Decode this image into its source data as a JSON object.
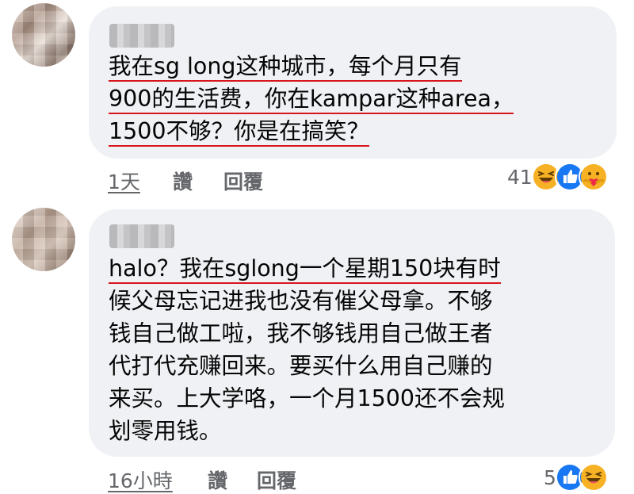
{
  "comments": [
    {
      "lines": [
        "我在sg long这种城市，每个月只有",
        "900的生活费，你在kampar这种area，",
        "1500不够？你是在搞笑？"
      ],
      "time": "1天",
      "like_label": "讚",
      "reply_label": "回覆",
      "reaction_count": "41",
      "reaction_icons": [
        "haha-icon",
        "like-icon",
        "care-icon"
      ]
    },
    {
      "lines": [
        "halo？我在sglong一个星期150块有时",
        "候父母忘记进我也没有催父母拿。不够",
        "钱自己做工啦，我不够钱用自己做王者",
        "代打代充赚回来。要买什么用自己赚的",
        "来买。上大学咯，一个月1500还不会规",
        "划零用钱。"
      ],
      "time": "16小時",
      "like_label": "讚",
      "reply_label": "回覆",
      "reaction_count": "5",
      "reaction_icons": [
        "like-icon",
        "haha-icon"
      ]
    }
  ],
  "colors": {
    "bubble": "#eff1f4",
    "text": "#050505",
    "meta": "#65676b",
    "underline": "#d8141c",
    "like_blue": "#1877f2",
    "haha_yellow": "#f7b125"
  }
}
